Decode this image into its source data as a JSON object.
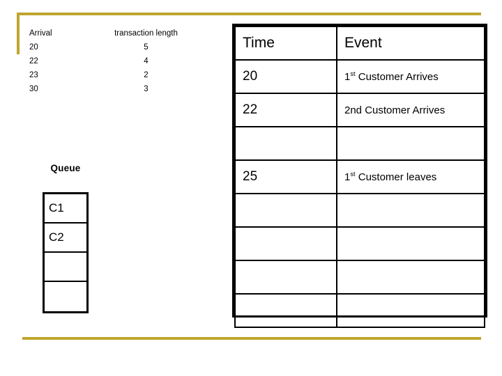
{
  "decor": {
    "accent_color": "#BFA52E"
  },
  "arrivals": {
    "headers": {
      "arrival": "Arrival",
      "transaction_length": "transaction length"
    },
    "rows": [
      {
        "arrival": "20",
        "length": "5"
      },
      {
        "arrival": "22",
        "length": "4"
      },
      {
        "arrival": "23",
        "length": "2"
      },
      {
        "arrival": "30",
        "length": "3"
      }
    ]
  },
  "queue": {
    "label": "Queue",
    "cells": [
      "C1",
      "C2",
      "",
      ""
    ]
  },
  "event_table": {
    "headers": {
      "time": "Time",
      "event": "Event"
    },
    "rows": [
      {
        "time": "20",
        "event_prefix": "1",
        "event_sup": "st",
        "event_suffix": " Customer Arrives"
      },
      {
        "time": "22",
        "event_prefix": "2nd Customer Arrives",
        "event_sup": "",
        "event_suffix": ""
      },
      {
        "time": "",
        "event_prefix": "",
        "event_sup": "",
        "event_suffix": ""
      },
      {
        "time": "25",
        "event_prefix": "1",
        "event_sup": "st",
        "event_suffix": " Customer leaves"
      },
      {
        "time": "",
        "event_prefix": "",
        "event_sup": "",
        "event_suffix": ""
      },
      {
        "time": "",
        "event_prefix": "",
        "event_sup": "",
        "event_suffix": ""
      },
      {
        "time": "",
        "event_prefix": "",
        "event_sup": "",
        "event_suffix": ""
      },
      {
        "time": "",
        "event_prefix": "",
        "event_sup": "",
        "event_suffix": ""
      }
    ]
  }
}
